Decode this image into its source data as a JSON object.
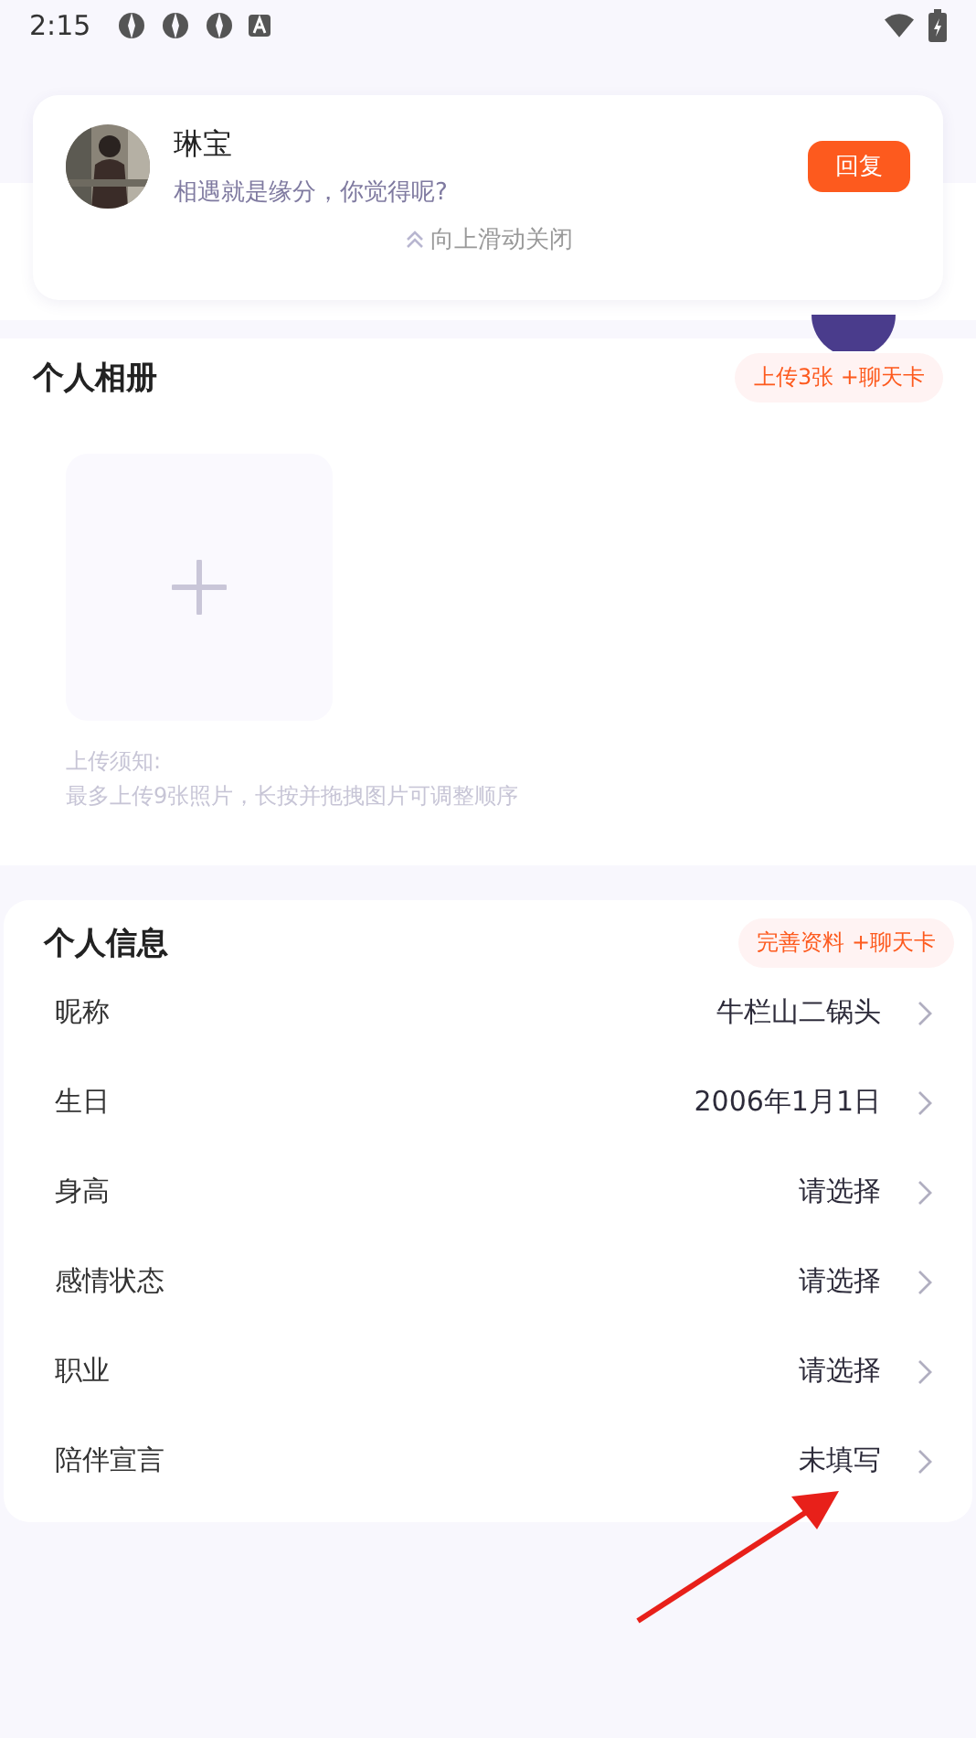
{
  "status_bar": {
    "time": "2:15"
  },
  "notification": {
    "name": "琳宝",
    "message": "相遇就是缘分，你觉得呢?",
    "reply_button": "回复",
    "dismiss_hint": "向上滑动关闭"
  },
  "album": {
    "title": "个人相册",
    "badge": "上传3张 +聊天卡",
    "notice_title": "上传须知:",
    "notice_text": "最多上传9张照片，长按并拖拽图片可调整顺序"
  },
  "info": {
    "title": "个人信息",
    "badge": "完善资料 +聊天卡",
    "rows": [
      {
        "label": "昵称",
        "value": "牛栏山二锅头"
      },
      {
        "label": "生日",
        "value": "2006年1月1日"
      },
      {
        "label": "身高",
        "value": "请选择"
      },
      {
        "label": "感情状态",
        "value": "请选择"
      },
      {
        "label": "职业",
        "value": "请选择"
      },
      {
        "label": "陪伴宣言",
        "value": "未填写"
      }
    ]
  }
}
